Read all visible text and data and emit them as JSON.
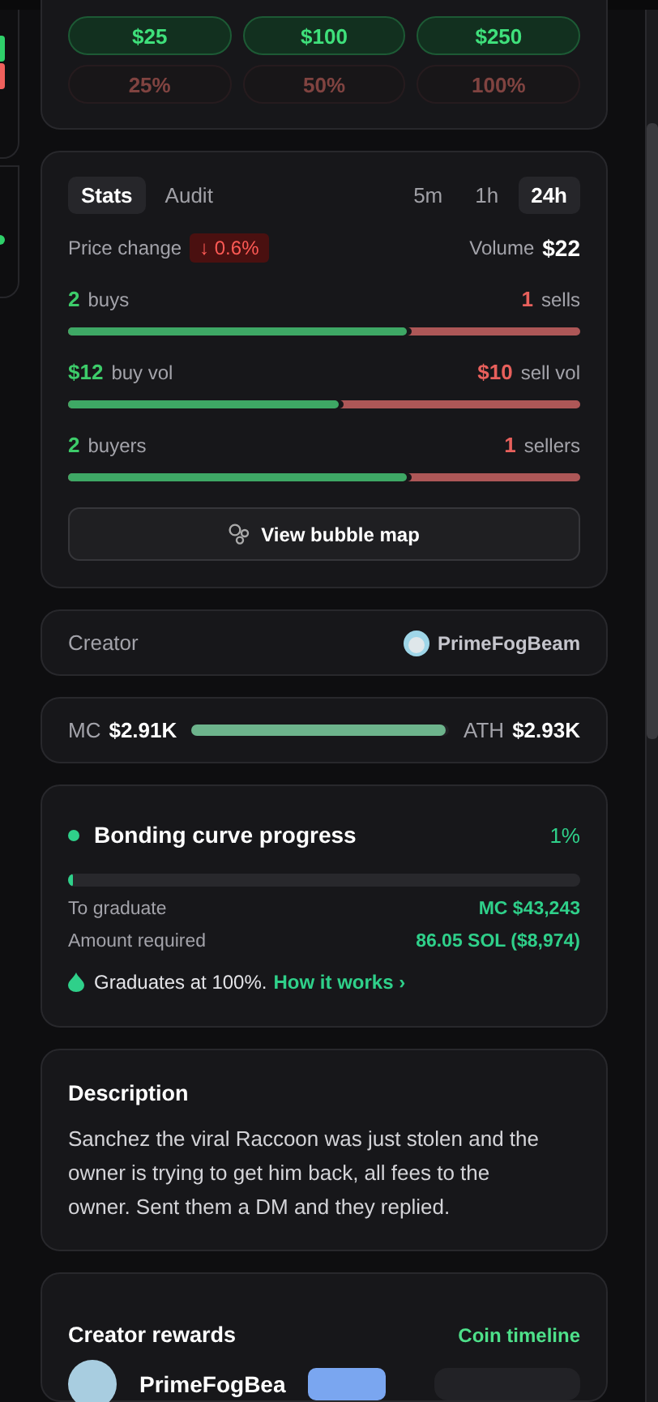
{
  "quick_buy": [
    {
      "label": "$25",
      "disabled": false
    },
    {
      "label": "$100",
      "disabled": false
    },
    {
      "label": "$250",
      "disabled": false
    }
  ],
  "quick_sell": [
    {
      "label": "25%",
      "disabled": true
    },
    {
      "label": "50%",
      "disabled": true
    },
    {
      "label": "100%",
      "disabled": true
    }
  ],
  "stats": {
    "tabs": [
      {
        "label": "Stats",
        "selected": true
      },
      {
        "label": "Audit",
        "selected": false
      }
    ],
    "timeframes": [
      {
        "label": "5m",
        "selected": false
      },
      {
        "label": "1h",
        "selected": false
      },
      {
        "label": "24h",
        "selected": true
      }
    ],
    "price_change": {
      "label": "Price change",
      "value": "↓ 0.6%"
    },
    "volume": {
      "label": "Volume",
      "value": "$22"
    },
    "rows": [
      {
        "buy_value": "2",
        "buy_label": "buys",
        "sell_value": "1",
        "sell_label": "sells",
        "level": 0.66
      },
      {
        "buy_value": "$12",
        "buy_label": "buy vol",
        "sell_value": "$10",
        "sell_label": "sell vol",
        "level": 0.53
      },
      {
        "buy_value": "2",
        "buy_label": "buyers",
        "sell_value": "1",
        "sell_label": "sellers",
        "level": 0.66
      }
    ],
    "bubble_map_button": "View bubble map"
  },
  "creator": {
    "label": "Creator",
    "name": "PrimeFogBeam"
  },
  "market_cap": {
    "label": "MC",
    "value": "$2.91K",
    "ath_label": "ATH",
    "ath_value": "$2.93K",
    "level": 0.99
  },
  "bonding": {
    "title": "Bonding curve progress",
    "percent": "1%",
    "level": 0.01,
    "rows": [
      {
        "label": "To graduate",
        "value": "MC $43,243"
      },
      {
        "label": "Amount required",
        "value": "86.05 SOL ($8,974)"
      }
    ],
    "note": "Graduates at 100%.",
    "link": "How it works ›"
  },
  "description": {
    "title": "Description",
    "text": "Sanchez the viral Raccoon was just stolen and the owner is trying to get him back, all fees to the owner. Sent them a DM and they replied."
  },
  "creator_rewards": {
    "title": "Creator rewards",
    "link": "Coin timeline",
    "name": "PrimeFogBea"
  }
}
